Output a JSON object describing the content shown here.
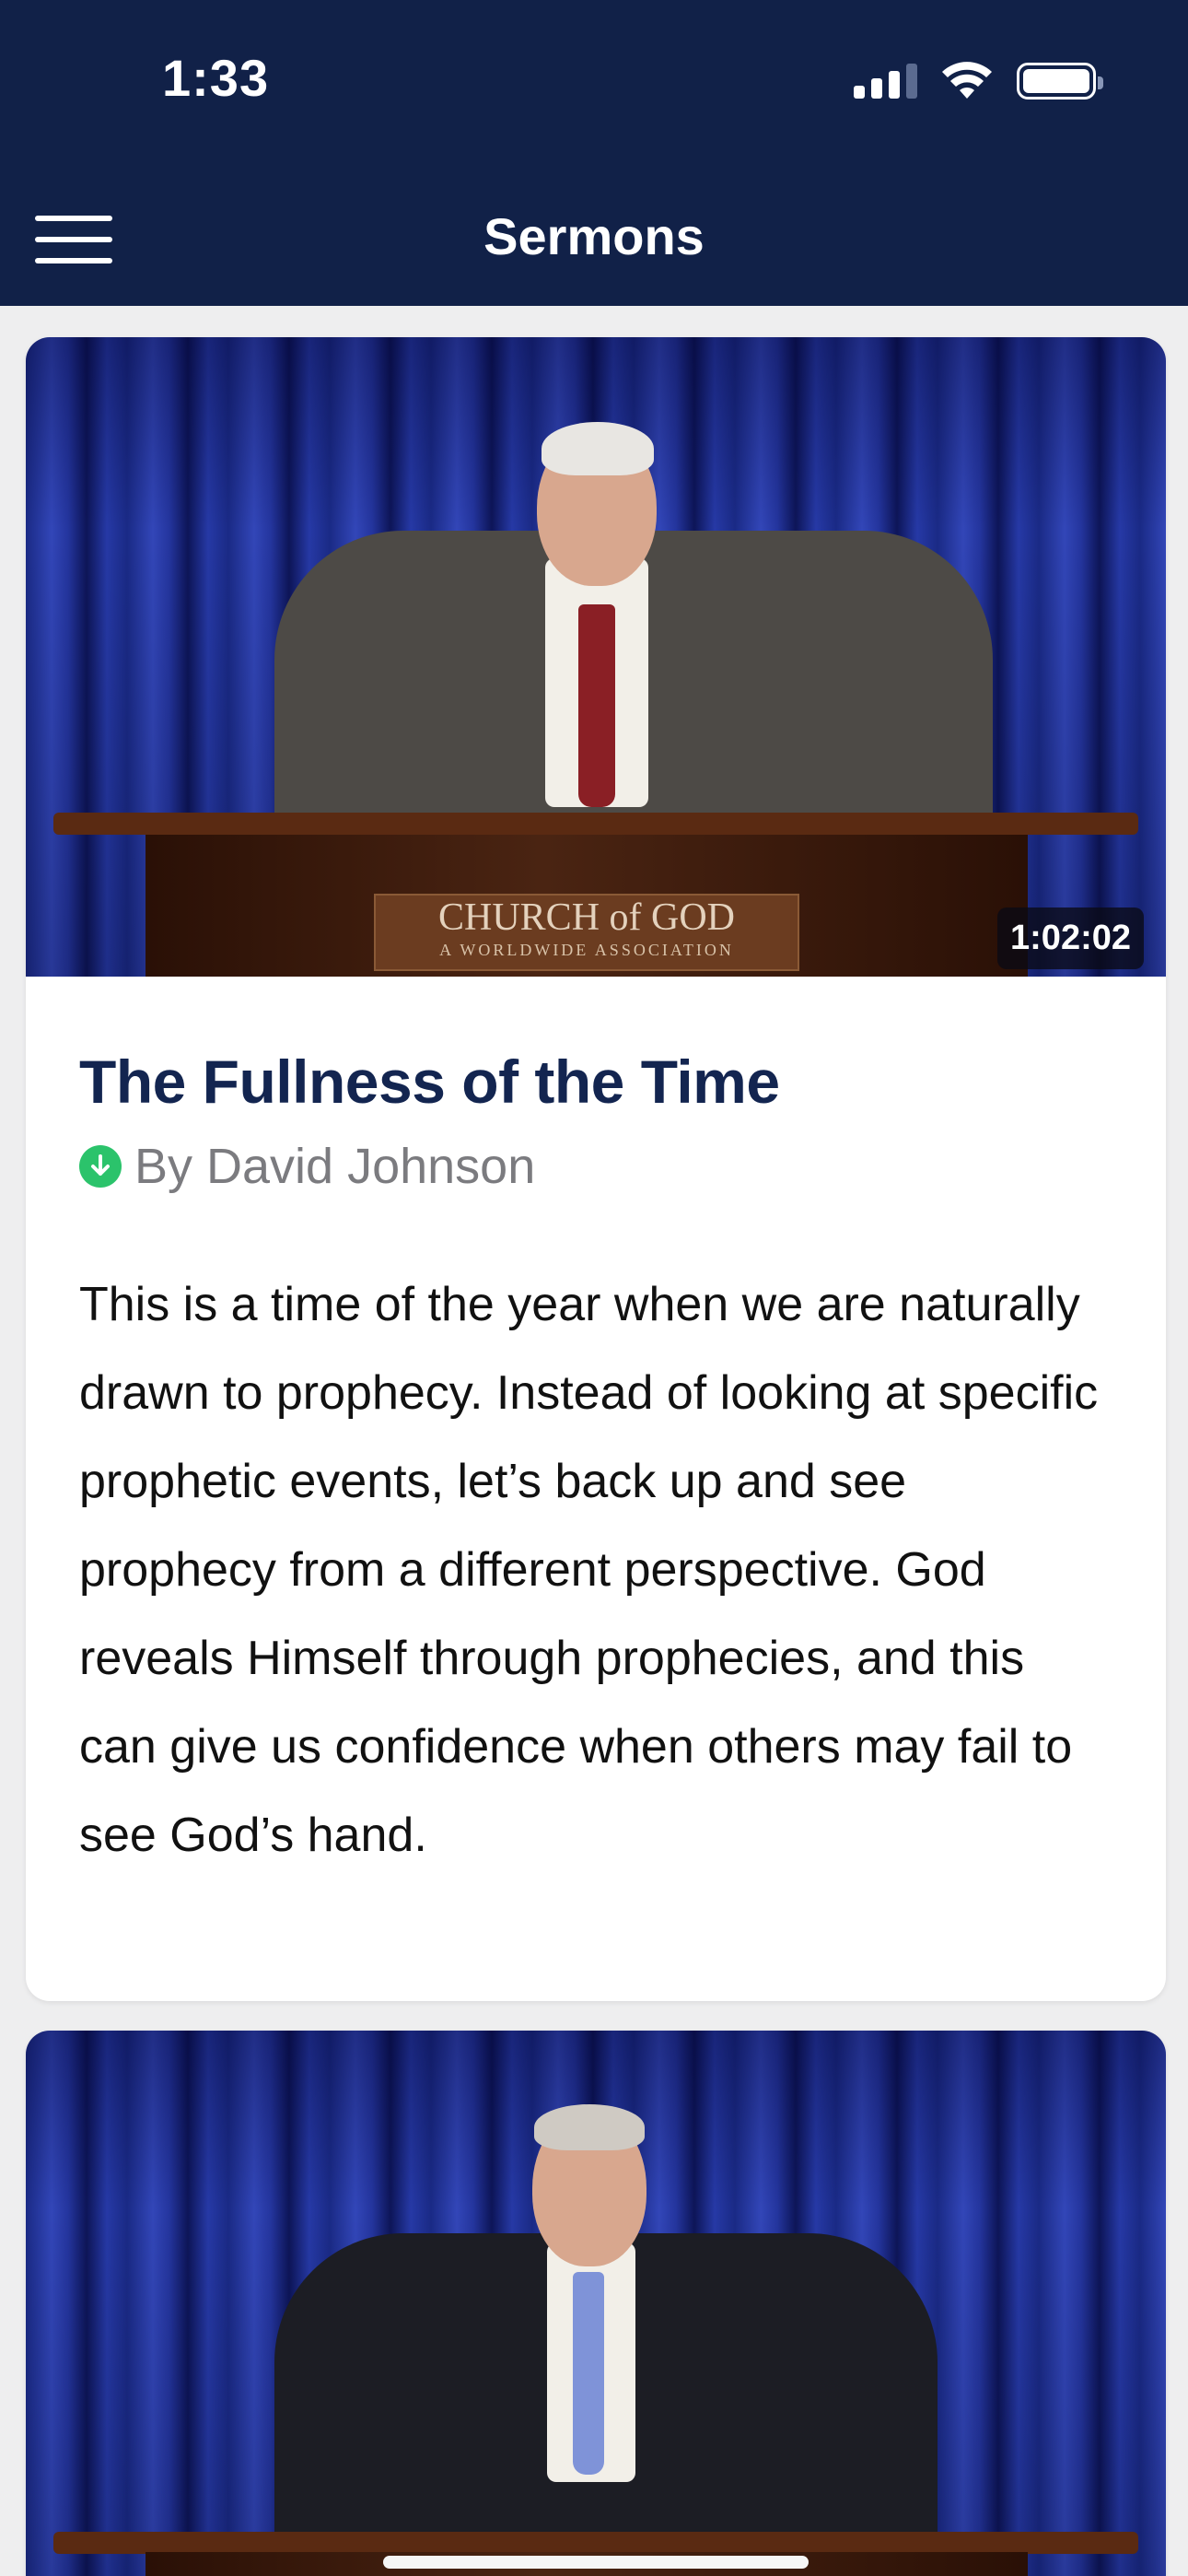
{
  "status_bar": {
    "time": "1:33"
  },
  "nav": {
    "title": "Sermons"
  },
  "sermons": [
    {
      "duration": "1:02:02",
      "podium_plaque": {
        "line1": "CHURCH of GOD",
        "line2": "A WORLDWIDE ASSOCIATION"
      },
      "title": "The Fullness of the Time",
      "author": "By David Johnson",
      "description": "This is a time of the year when we are naturally drawn to prophecy. Instead of looking at specific prophetic events, let’s back up and see prophecy from a different perspective. God reveals Himself through prophecies, and this can give us confidence when others may fail to see God’s hand."
    },
    {
      "duration": "",
      "title": "",
      "author": "",
      "description": ""
    }
  ],
  "colors": {
    "nav_bg": "#112148",
    "title": "#132550",
    "download_badge": "#2bc36b"
  },
  "icons": [
    "hamburger-menu-icon",
    "cellular-signal-icon",
    "wifi-icon",
    "battery-icon",
    "download-icon"
  ]
}
